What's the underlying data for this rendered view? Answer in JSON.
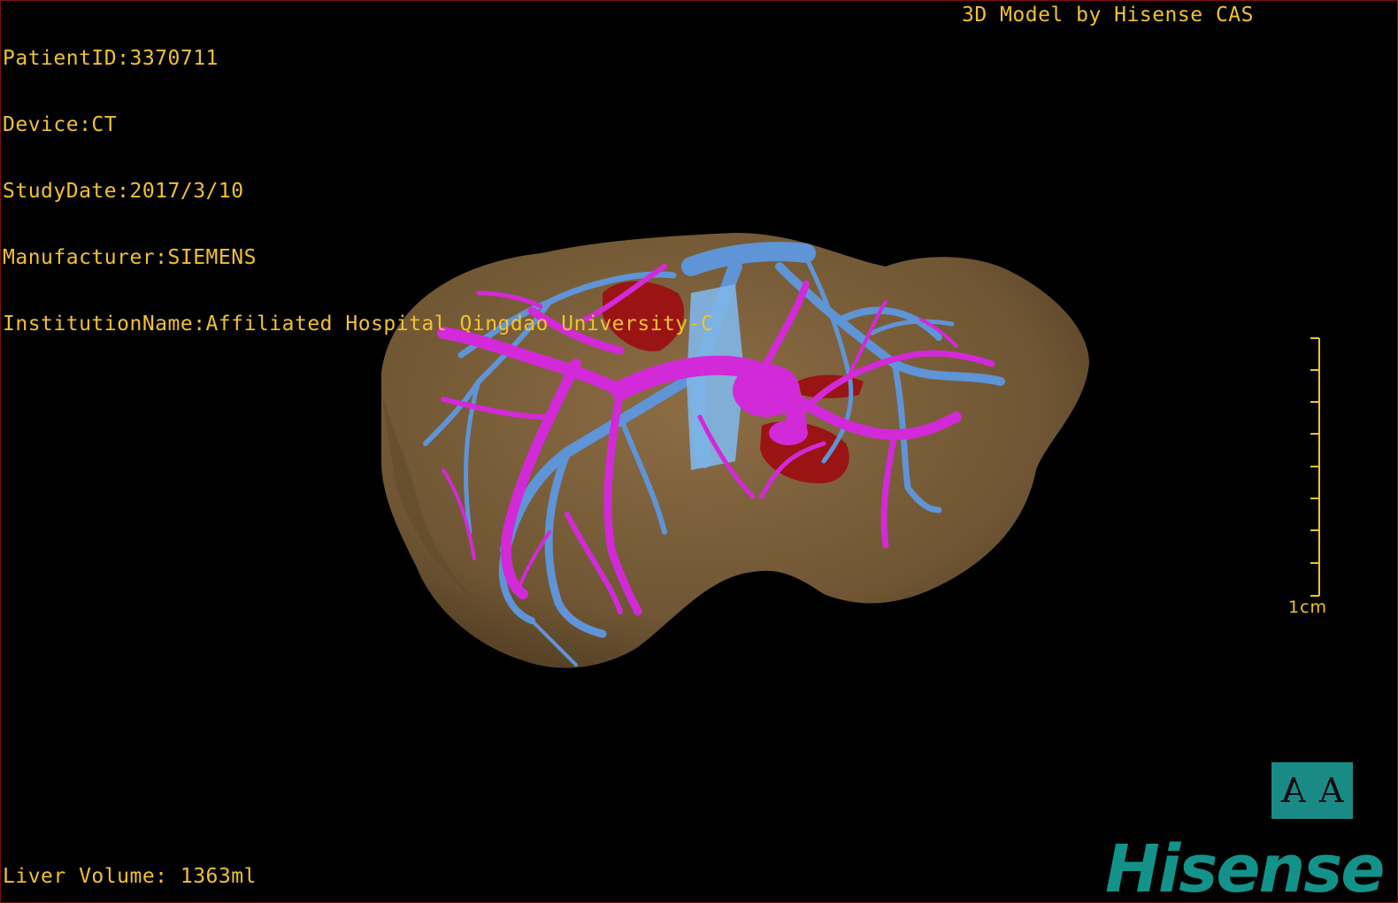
{
  "patient_info": {
    "patient_id": "PatientID:3370711",
    "device": "Device:CT",
    "study_date": "StudyDate:2017/3/10",
    "manufacturer": "Manufacturer:SIEMENS",
    "institution": "InstitutionName:Affiliated Hospital Qingdao University-C"
  },
  "model_credit": "3D Model by Hisense CAS",
  "liver_volume": "Liver Volume: 1363ml",
  "scale_bar": {
    "label": "1cm"
  },
  "orientation_cube": {
    "left_glyph": "A",
    "right_glyph": "A"
  },
  "brand_logo": "Hisense",
  "colors": {
    "overlay_text": "#f2c12e",
    "liver": "#7a5f3a",
    "portal_vein": "#d22ad8",
    "hepatic_vein": "#5f94d6",
    "artery": "#9a1414",
    "brand": "#13928a",
    "viewport_border": "#7a1010"
  }
}
